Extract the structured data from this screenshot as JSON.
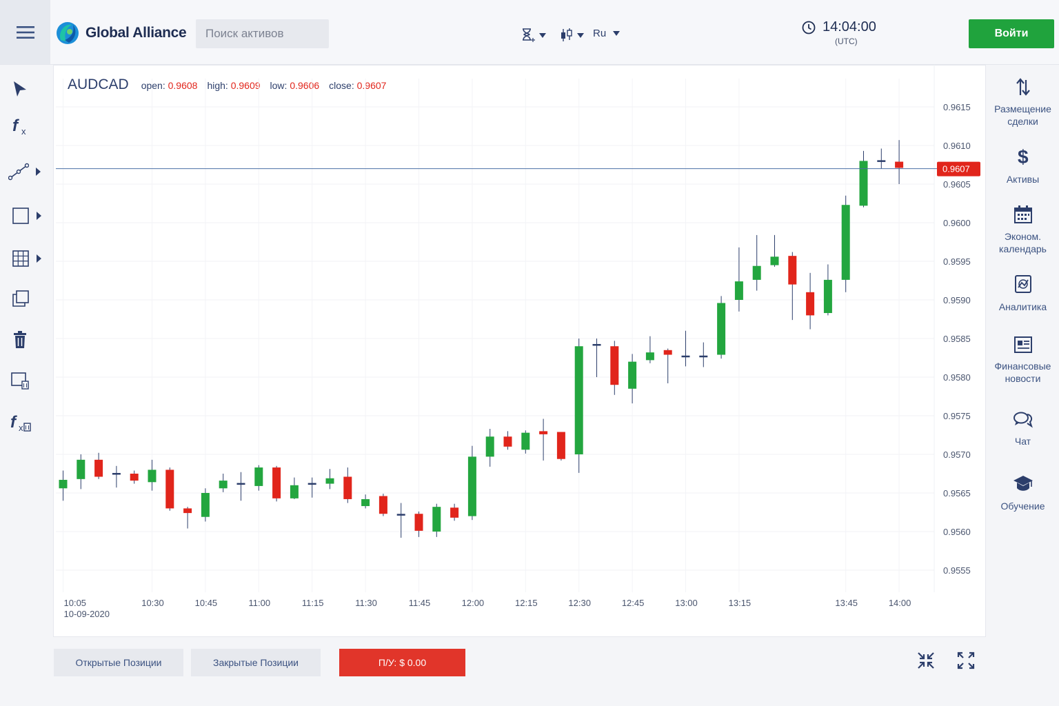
{
  "header": {
    "logo_text": "Global Alliance",
    "search_placeholder": "Поиск активов",
    "language": "Ru",
    "time": "14:04:00",
    "timezone": "(UTC)",
    "login_label": "Войти"
  },
  "left_toolbar": {
    "icons": [
      "cursor-icon",
      "function-icon",
      "line-tool-icon",
      "rectangle-icon",
      "grid-icon",
      "copy-icon",
      "trash-icon",
      "remove-drawings-icon",
      "remove-indicators-icon"
    ]
  },
  "chart": {
    "symbol": "AUDCAD",
    "open_label": "open:",
    "open_value": "0.9608",
    "high_label": "high:",
    "high_value": "0.9609",
    "low_label": "low:",
    "low_value": "0.9606",
    "close_label": "close:",
    "close_value": "0.9607",
    "current_price": "0.9607",
    "date_label": "10-09-2020",
    "colors": {
      "up": "#23a63f",
      "down": "#e1251b",
      "price_line": "#4a6fa5"
    }
  },
  "chart_data": {
    "type": "candlestick",
    "title": "AUDCAD",
    "ylim": [
      0.9551,
      0.9617
    ],
    "y_ticks": [
      "0.9615",
      "0.9610",
      "0.9605",
      "0.9600",
      "0.9595",
      "0.9590",
      "0.9585",
      "0.9580",
      "0.9575",
      "0.9570",
      "0.9565",
      "0.9560",
      "0.9555"
    ],
    "x_ticks": [
      {
        "label": "10:05",
        "i": 0
      },
      {
        "label": "10:30",
        "i": 5
      },
      {
        "label": "10:45",
        "i": 8
      },
      {
        "label": "11:00",
        "i": 11
      },
      {
        "label": "11:15",
        "i": 14
      },
      {
        "label": "11:30",
        "i": 17
      },
      {
        "label": "11:45",
        "i": 20
      },
      {
        "label": "12:00",
        "i": 23
      },
      {
        "label": "12:15",
        "i": 26
      },
      {
        "label": "12:30",
        "i": 29
      },
      {
        "label": "12:45",
        "i": 32
      },
      {
        "label": "13:00",
        "i": 35
      },
      {
        "label": "13:15",
        "i": 38
      },
      {
        "label": "13:45",
        "i": 44
      },
      {
        "label": "14:00",
        "i": 47
      }
    ],
    "grid": true,
    "candles": [
      [
        0.95656,
        0.95667,
        0.95679,
        0.9564
      ],
      [
        0.95668,
        0.95693,
        0.957,
        0.95655
      ],
      [
        0.95693,
        0.95671,
        0.95702,
        0.95668
      ],
      [
        0.95675,
        0.95675,
        0.95685,
        0.95657
      ],
      [
        0.95675,
        0.95666,
        0.95679,
        0.95662
      ],
      [
        0.95664,
        0.9568,
        0.95693,
        0.95653
      ],
      [
        0.9568,
        0.9563,
        0.95683,
        0.95627
      ],
      [
        0.9563,
        0.95624,
        0.95632,
        0.95604
      ],
      [
        0.95619,
        0.9565,
        0.95656,
        0.95613
      ],
      [
        0.95656,
        0.95666,
        0.95675,
        0.95651
      ],
      [
        0.95662,
        0.95662,
        0.95677,
        0.9564
      ],
      [
        0.95659,
        0.95683,
        0.95686,
        0.95653
      ],
      [
        0.95683,
        0.95643,
        0.95685,
        0.95639
      ],
      [
        0.95643,
        0.9566,
        0.9567,
        0.95642
      ],
      [
        0.95662,
        0.95662,
        0.9567,
        0.95644
      ],
      [
        0.95662,
        0.95669,
        0.95681,
        0.95655
      ],
      [
        0.95671,
        0.95642,
        0.95683,
        0.95637
      ],
      [
        0.95633,
        0.95642,
        0.95648,
        0.9563
      ],
      [
        0.95646,
        0.95623,
        0.95649,
        0.9562
      ],
      [
        0.95622,
        0.95622,
        0.95637,
        0.95592
      ],
      [
        0.95623,
        0.95601,
        0.95626,
        0.95593
      ],
      [
        0.956,
        0.95632,
        0.95636,
        0.95593
      ],
      [
        0.95631,
        0.95618,
        0.95636,
        0.95614
      ],
      [
        0.9562,
        0.95697,
        0.95711,
        0.95615
      ],
      [
        0.95697,
        0.95723,
        0.95733,
        0.95684
      ],
      [
        0.95723,
        0.9571,
        0.9573,
        0.95706
      ],
      [
        0.95706,
        0.95728,
        0.95731,
        0.95701
      ],
      [
        0.9573,
        0.95726,
        0.95746,
        0.95692
      ],
      [
        0.95729,
        0.95694,
        0.95729,
        0.95692
      ],
      [
        0.957,
        0.9584,
        0.9585,
        0.95676
      ],
      [
        0.95842,
        0.95842,
        0.9585,
        0.958
      ],
      [
        0.9584,
        0.9579,
        0.95847,
        0.95777
      ],
      [
        0.95785,
        0.9582,
        0.9583,
        0.95766
      ],
      [
        0.95822,
        0.95832,
        0.95853,
        0.95818
      ],
      [
        0.95835,
        0.95829,
        0.95837,
        0.95792
      ],
      [
        0.95827,
        0.95827,
        0.9586,
        0.95814
      ],
      [
        0.95827,
        0.95827,
        0.95845,
        0.95813
      ],
      [
        0.95829,
        0.95896,
        0.95905,
        0.95824
      ],
      [
        0.959,
        0.95924,
        0.95968,
        0.95885
      ],
      [
        0.95926,
        0.95944,
        0.95984,
        0.95912
      ],
      [
        0.95945,
        0.95956,
        0.95984,
        0.95943
      ],
      [
        0.95957,
        0.9592,
        0.95962,
        0.95874
      ],
      [
        0.9591,
        0.9588,
        0.95935,
        0.95862
      ],
      [
        0.95883,
        0.95926,
        0.95946,
        0.9588
      ],
      [
        0.95926,
        0.96023,
        0.96035,
        0.9591
      ],
      [
        0.96022,
        0.9608,
        0.96093,
        0.9602
      ],
      [
        0.9608,
        0.9608,
        0.96096,
        0.9607
      ],
      [
        0.96079,
        0.96071,
        0.96107,
        0.9605
      ]
    ]
  },
  "right_panel": {
    "items": [
      {
        "label": "Размещение сделки",
        "icon": "trade-arrows-icon"
      },
      {
        "label": "Активы",
        "icon": "dollar-icon"
      },
      {
        "label": "Эконом. календарь",
        "icon": "calendar-icon"
      },
      {
        "label": "Аналитика",
        "icon": "analytics-icon"
      },
      {
        "label": "Финансовые новости",
        "icon": "news-icon"
      },
      {
        "label": "Чат",
        "icon": "chat-icon"
      },
      {
        "label": "Обучение",
        "icon": "education-icon"
      }
    ]
  },
  "bottom": {
    "open_positions": "Открытые Позиции",
    "closed_positions": "Закрытые Позиции",
    "pl": "П/У: $ 0.00"
  }
}
